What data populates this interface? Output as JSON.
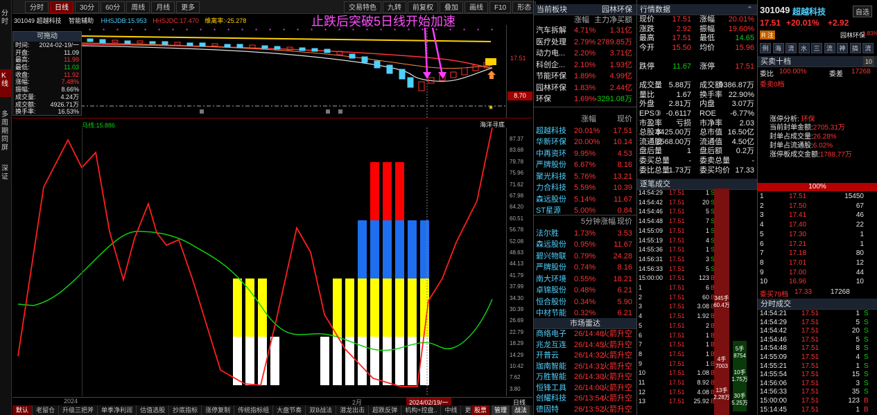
{
  "left_tabs": [
    "分时",
    "K线",
    "多周期同屏",
    "深证"
  ],
  "chart_toolbar": {
    "buttons": [
      "分时",
      "日线",
      "30分",
      "60分",
      "周线",
      "月线",
      "更多"
    ],
    "active": "日线",
    "right_buttons": [
      "交易特色",
      "九转",
      "前复权",
      "叠加",
      "画线",
      "F10",
      "形态"
    ]
  },
  "stock_line": {
    "code": "301049",
    "name": "超越科技",
    "indicator": "智能辅助",
    "ma1": "HHSJDB:15.953",
    "ma2": "HHSJDC:17.470",
    "ma3": "维离率:-25.278"
  },
  "annotation": "止跌后突破5日线开始加速",
  "info_box": {
    "title": "可拖动",
    "rows": [
      [
        "时间:",
        "2024-02-19/一"
      ],
      [
        "开盘:",
        "11.09"
      ],
      [
        "最高:",
        "11.99"
      ],
      [
        "最低:",
        "11.03"
      ],
      [
        "收盘:",
        "11.92"
      ],
      [
        "涨幅:",
        "7.48%"
      ],
      [
        "振幅:",
        "8.66%"
      ],
      [
        "成交量:",
        "4.24万"
      ],
      [
        "成交额:",
        "4926.71万"
      ],
      [
        "换手率:",
        "16.53%"
      ]
    ]
  },
  "price_axis": {
    "top": "17.51",
    "flag": "8.70"
  },
  "lower_indicator": {
    "label": "马线:15.886",
    "tag": "海洋寻底"
  },
  "lower_axis": [
    "87.37",
    "83.68",
    "79.78",
    "75.96",
    "71.62",
    "67.98",
    "64.20",
    "60.51",
    "56.78",
    "52.08",
    "48.63",
    "44.13",
    "41.79",
    "37.99",
    "34.30",
    "30.39",
    "26.69",
    "22.79",
    "18.29",
    "14.29",
    "10.42",
    "7.62",
    "3.80"
  ],
  "x_axis": {
    "left": "2024",
    "mid": "2月",
    "cursor": "2024/02/19/一",
    "tag": "日线"
  },
  "bottom_tabs": [
    "默认",
    "老留仓",
    "升级三把斧",
    "单季净利润",
    "估值选股",
    "抄底指标",
    "涨停复制",
    "传统指标组",
    "大盘节奏",
    "双B战法",
    "潜龙出击",
    "超跌反弹",
    "机构+控盘..",
    "中线",
    "更多"
  ],
  "bottom_right": [
    "股票",
    "管理",
    "战法"
  ],
  "sector": {
    "title": "当前板块",
    "col1": "涨幅",
    "col2": "主力净买额",
    "rows": [
      [
        "汽车拆解",
        "4.71%",
        "1.31亿"
      ],
      [
        "医疗处理",
        "2.79%",
        "2789.85万"
      ],
      [
        "动力电...",
        "2.20%",
        "3.71亿"
      ],
      [
        "科创企...",
        "2.10%",
        "1.93亿"
      ],
      [
        "节能环保",
        "1.89%",
        "4.99亿"
      ],
      [
        "园林环保",
        "1.83%",
        "2.44亿"
      ],
      [
        "环保",
        "1.69%",
        "-3291.08万"
      ]
    ],
    "right": "园林环保"
  },
  "leaders": {
    "col1": "涨幅",
    "col2": "现价",
    "rows": [
      [
        "超越科技",
        "20.01%",
        "17.51"
      ],
      [
        "华新环保",
        "20.00%",
        "10.14"
      ],
      [
        "中再资环",
        "9.95%",
        "4.53"
      ],
      [
        "严牌股份",
        "6.67%",
        "8.16"
      ],
      [
        "聚光科技",
        "5.76%",
        "13.21"
      ],
      [
        "力合科技",
        "5.59%",
        "10.39"
      ],
      [
        "森远股份",
        "5.14%",
        "11.67"
      ],
      [
        "ST星源",
        "5.00%",
        "0.84"
      ]
    ]
  },
  "five_min": {
    "col1": "5分钟涨幅",
    "col2": "现价",
    "rows": [
      [
        "法尔胜",
        "1.73%",
        "3.53"
      ],
      [
        "森远股份",
        "0.95%",
        "11.67"
      ],
      [
        "碧兴物联",
        "0.79%",
        "24.28"
      ],
      [
        "严牌股份",
        "0.74%",
        "8.16"
      ],
      [
        "南大环境",
        "0.55%",
        "18.21"
      ],
      [
        "卓锦股份",
        "0.48%",
        "6.21"
      ],
      [
        "恒合股份",
        "0.34%",
        "5.90"
      ],
      [
        "中材节能",
        "0.32%",
        "6.21"
      ]
    ]
  },
  "radar": {
    "title": "市场雷达",
    "rows": [
      [
        "商络电子",
        "26/14:46",
        "火箭升空"
      ],
      [
        "兆龙互连",
        "26/14:45",
        "火箭升空"
      ],
      [
        "开普云",
        "26/14:32",
        "火箭升空"
      ],
      [
        "珈南智能",
        "26/14:31",
        "火箭升空"
      ],
      [
        "万胜智能",
        "26/14:30",
        "火箭升空"
      ],
      [
        "恒锋工具",
        "26/14:00",
        "火箭升空"
      ],
      [
        "创耀科技",
        "26/13:54",
        "火箭升空"
      ],
      [
        "德固特",
        "26/13:52",
        "火箭升空"
      ]
    ]
  },
  "quote": {
    "title": "行情数据",
    "rows": [
      [
        "现价",
        "17.51",
        "涨幅",
        "20.01%"
      ],
      [
        "涨跌",
        "2.92",
        "振幅",
        "19.60%"
      ],
      [
        "最高",
        "17.51",
        "最低",
        "14.65"
      ],
      [
        "今开",
        "15.50",
        "均价",
        "15.96"
      ],
      [
        "",
        "",
        " ",
        ""
      ],
      [
        "跌停",
        "11.67",
        "涨停",
        "17.51"
      ],
      [
        "",
        "",
        " ",
        ""
      ],
      [
        "成交量",
        "5.88万",
        "成交额",
        "9386.87万"
      ],
      [
        "量比",
        "1.67",
        "换手率",
        "22.90%"
      ],
      [
        "外盘",
        "2.81万",
        "内盘",
        "3.07万"
      ],
      [
        "EPS③",
        "-0.6117",
        "ROE",
        "-6.77%"
      ],
      [
        "市盈率",
        "亏损",
        "市净率",
        "2.03"
      ],
      [
        "总股本",
        "9425.00万",
        "总市值",
        "16.50亿"
      ],
      [
        "流通股",
        "2568.00万",
        "流通值",
        "4.50亿"
      ],
      [
        "盘后量",
        "1",
        "盘后额",
        "0.2万"
      ],
      [
        "委买总量",
        "-",
        "委卖总量",
        "-"
      ],
      [
        "委比总量",
        "1.73万",
        "委买均价",
        "17.33"
      ]
    ]
  },
  "tick_title": "逐笔成交",
  "ticks": [
    [
      "14:54:29",
      "17.51",
      "1",
      "S"
    ],
    [
      "14:54:42",
      "17.51",
      "20",
      "S"
    ],
    [
      "14:54:46",
      "17.51",
      "5",
      "S"
    ],
    [
      "14:54:48",
      "17.51",
      "7",
      "S"
    ],
    [
      "14:55:09",
      "17.51",
      "1",
      "S"
    ],
    [
      "14:55:19",
      "17.51",
      "4",
      "S"
    ],
    [
      "14:55:36",
      "17.51",
      "1",
      "S"
    ],
    [
      "14:56:31",
      "17.51",
      "3",
      "S"
    ],
    [
      "14:56:33",
      "17.51",
      "5",
      "S"
    ],
    [
      "15:00:00",
      "17.51",
      "123",
      "B"
    ],
    [
      "1",
      "17.51",
      "6",
      "B"
    ],
    [
      "2",
      "17.51",
      "60",
      "B"
    ],
    [
      "3",
      "17.51",
      "3.08",
      "B"
    ],
    [
      "4",
      "17.51",
      "1.92",
      "B"
    ],
    [
      "5",
      "17.51",
      "2",
      "B"
    ],
    [
      "6",
      "17.51",
      "1",
      "B"
    ],
    [
      "7",
      "17.51",
      "1",
      "B"
    ],
    [
      "8",
      "17.51",
      "1",
      "B"
    ],
    [
      "9",
      "17.51",
      "1",
      "B"
    ],
    [
      "10",
      "17.51",
      "1.08",
      "B"
    ],
    [
      "11",
      "17.51",
      "8.92",
      "B"
    ],
    [
      "12",
      "17.51",
      "4.08",
      "B"
    ],
    [
      "13",
      "17.51",
      "25.92",
      "B"
    ]
  ],
  "tick_blocks": {
    "a": "345手\n60.4万",
    "b": "4手\n7003",
    "c": "13手\n2.28万",
    "d": "5手\n8754",
    "e": "10手\n1.75万",
    "f": "30手\n5.25万"
  },
  "stock_header": {
    "code": "301049",
    "name": "超越科技",
    "price": "17.51",
    "pct": "+20.01%",
    "chg": "+2.92",
    "select": "自选",
    "tag": "R 注",
    "sector": "园林环保",
    "sector_pct": "1.83%"
  },
  "quick_btns": [
    "例",
    "海",
    "流",
    "水",
    "三",
    "流",
    "神",
    "搞",
    "流"
  ],
  "order_book": {
    "title": "买卖十档",
    "wb_label": "委比",
    "wb": "100.00%",
    "wc_label": "委差",
    "wc": "17268",
    "sell_label": "委卖0档",
    "buy_label": "委买79档",
    "buy_val": "17.33",
    "buy_total": "17268"
  },
  "analysis": {
    "title": "涨停分析:",
    "title_val": "环保",
    "rows": [
      [
        "当前封单金额:",
        "2705.31万"
      ],
      [
        "封单占成交量:",
        "26.28%"
      ],
      [
        "封单占流通股:",
        "6.02%"
      ],
      [
        "涨停板成交金额:",
        "1788.77万"
      ]
    ]
  },
  "full_bar": "100%",
  "buy_levels": [
    [
      "1",
      "17.51",
      "15450"
    ],
    [
      "2",
      "17.50",
      "67"
    ],
    [
      "3",
      "17.41",
      "46"
    ],
    [
      "4",
      "17.40",
      "22"
    ],
    [
      "5",
      "17.30",
      "1"
    ],
    [
      "6",
      "17.21",
      "1"
    ],
    [
      "7",
      "17.18",
      "80"
    ],
    [
      "8",
      "17.01",
      "12"
    ],
    [
      "9",
      "17.00",
      "44"
    ],
    [
      "10",
      "16.96",
      "10"
    ]
  ],
  "time_sales_title": "分时成交",
  "time_sales": [
    [
      "14:54:21",
      "17.51",
      "1",
      "S"
    ],
    [
      "14:54:29",
      "17.51",
      "5",
      "S"
    ],
    [
      "14:54:42",
      "17.51",
      "20",
      "S"
    ],
    [
      "14:54:46",
      "17.51",
      "5",
      "S"
    ],
    [
      "14:54:48",
      "17.51",
      "8",
      "S"
    ],
    [
      "14:55:09",
      "17.51",
      "4",
      "S"
    ],
    [
      "14:55:21",
      "17.51",
      "1",
      "S"
    ],
    [
      "14:55:54",
      "17.51",
      "15",
      "S"
    ],
    [
      "14:56:06",
      "17.51",
      "3",
      "S"
    ],
    [
      "14:56:33",
      "17.51",
      "35",
      "S"
    ],
    [
      "15:00:00",
      "17.51",
      "123",
      "B"
    ],
    [
      "15:14:45",
      "17.51",
      "1",
      "B"
    ]
  ]
}
